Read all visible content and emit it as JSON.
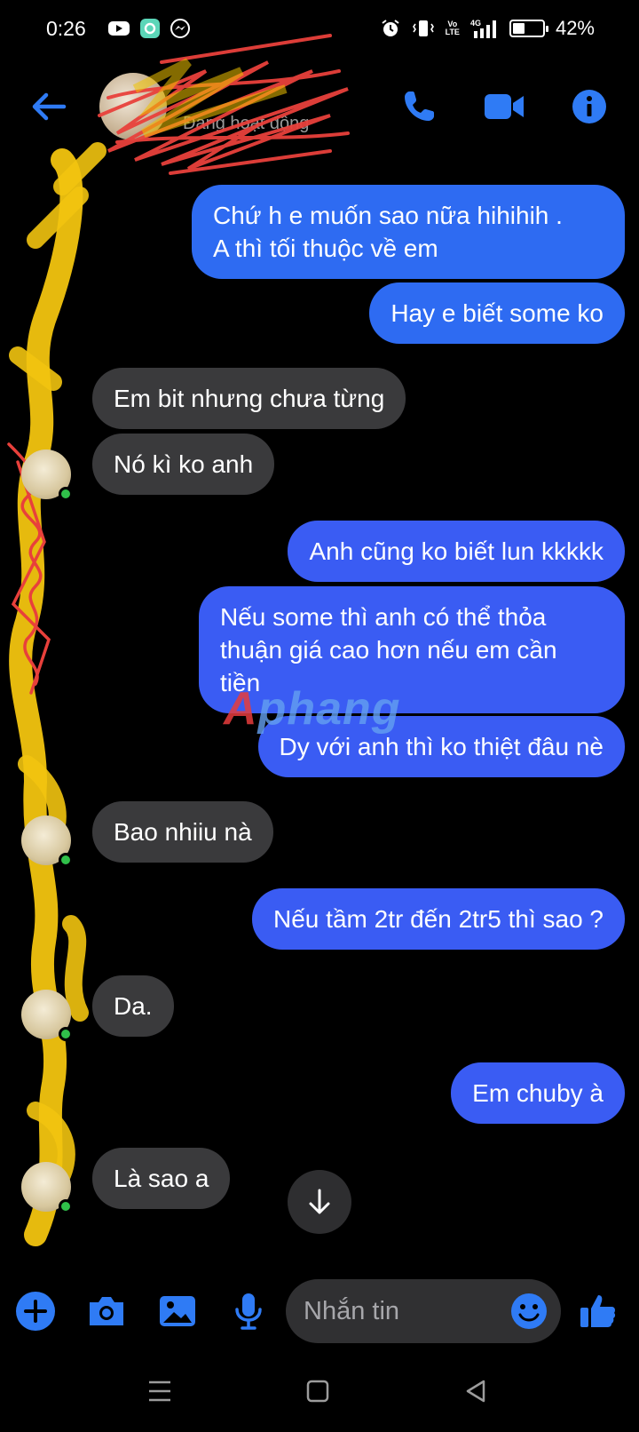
{
  "status_bar": {
    "time": "0:26",
    "network": "4G",
    "volte_line1": "Vo",
    "volte_line2": "LTE",
    "battery_text": "42%",
    "battery_level": 0.42
  },
  "header": {
    "contact_name": "",
    "contact_status": "Đang hoạt động",
    "icons": [
      "back-arrow-icon",
      "phone-icon",
      "video-camera-icon",
      "info-icon"
    ]
  },
  "messages": [
    {
      "id": 1,
      "side": "out",
      "text": "Chứ h e muốn sao nữa hihihih .\nA thì tối thuộc về em"
    },
    {
      "id": 2,
      "side": "out",
      "text": "Hay e biết some ko"
    },
    {
      "id": 3,
      "side": "in",
      "text": "Em bit nhưng chưa từng"
    },
    {
      "id": 4,
      "side": "in",
      "text": "Nó kì ko anh"
    },
    {
      "id": 5,
      "side": "out",
      "text": "Anh cũng ko biết lun kkkkk"
    },
    {
      "id": 6,
      "side": "out",
      "text": "Nếu some thì anh có thể thỏa\nthuận giá cao hơn nếu em cần\ntiền"
    },
    {
      "id": 7,
      "side": "out",
      "text": "Dy với anh thì ko thiệt đâu nè"
    },
    {
      "id": 8,
      "side": "in",
      "text": "Bao nhiiu nà"
    },
    {
      "id": 9,
      "side": "out",
      "text": "Nếu tầm 2tr đến 2tr5 thì sao ?"
    },
    {
      "id": 10,
      "side": "in",
      "text": "Da."
    },
    {
      "id": 11,
      "side": "out",
      "text": "Em chuby à"
    },
    {
      "id": 12,
      "side": "in",
      "text": "Là sao a"
    }
  ],
  "watermark": {
    "accent": "A",
    "rest": "phang"
  },
  "composer": {
    "placeholder": "Nhắn tin",
    "icons": [
      "plus-icon",
      "camera-icon",
      "image-icon",
      "microphone-icon",
      "emoji-icon",
      "thumbs-up-icon"
    ]
  },
  "colors": {
    "accent": "#2e6bf2",
    "incoming_bubble": "#3a3a3c",
    "background": "#000000",
    "online": "#30c04a",
    "icon_blue": "#2f7bf5"
  }
}
